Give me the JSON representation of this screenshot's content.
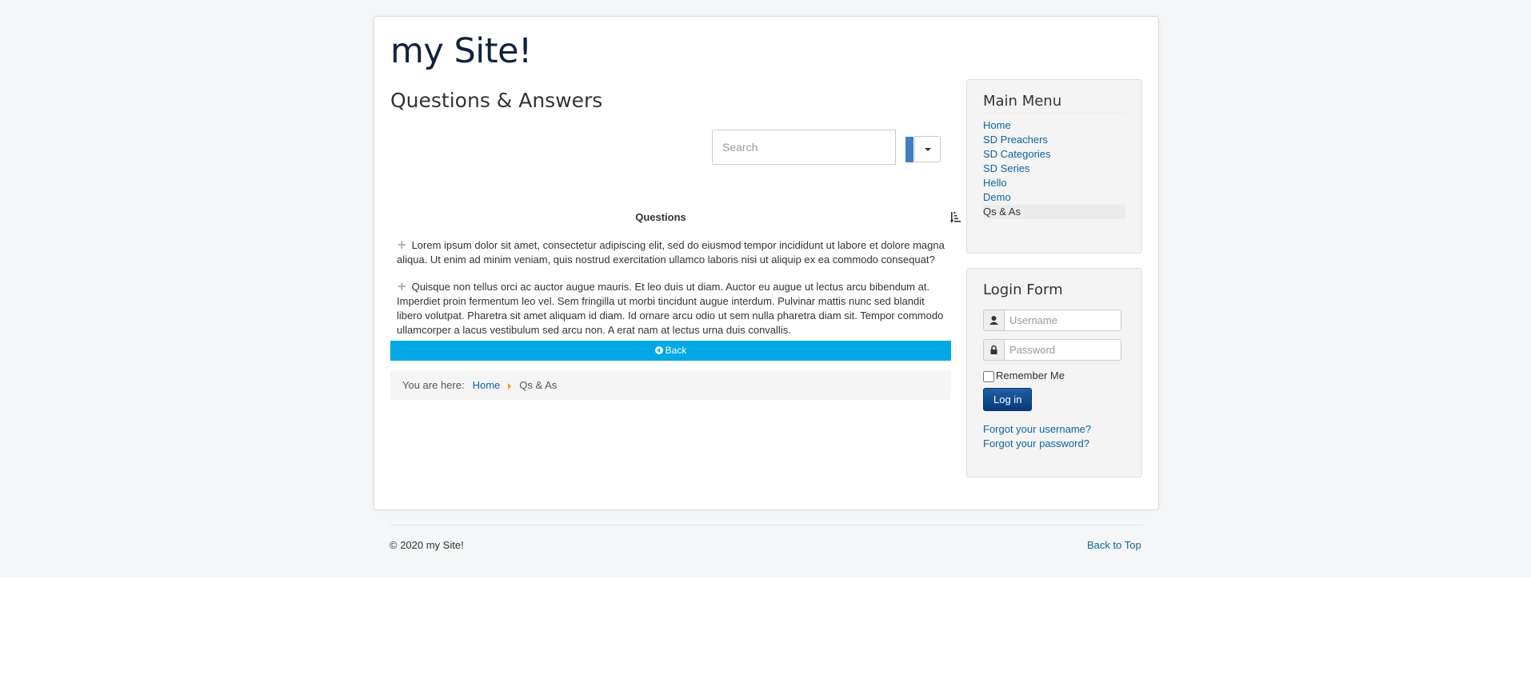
{
  "site": {
    "brand": "my Site!"
  },
  "page": {
    "title": "Questions & Answers"
  },
  "search": {
    "placeholder": "Search"
  },
  "questions": {
    "header": "Questions",
    "items": [
      "Lorem ipsum dolor sit amet, consectetur adipiscing elit, sed do eiusmod tempor incididunt ut labore et dolore magna aliqua. Ut enim ad minim veniam, quis nostrud exercitation ullamco laboris nisi ut aliquip ex ea commodo consequat?",
      "Quisque non tellus orci ac auctor augue mauris. Et leo duis ut diam. Auctor eu augue ut lectus arcu bibendum at. Imperdiet proin fermentum leo vel. Sem fringilla ut morbi tincidunt augue interdum. Pulvinar mattis nunc sed blandit libero volutpat. Pharetra sit amet aliquam id diam. Id ornare arcu odio ut sem nulla pharetra diam sit. Tempor commodo ullamcorper a lacus vestibulum sed arcu non. A erat nam at lectus urna duis convallis."
    ]
  },
  "back_button": {
    "label": "Back"
  },
  "breadcrumb": {
    "prefix": "You are here:",
    "home": "Home",
    "current": "Qs & As"
  },
  "main_menu": {
    "title": "Main Menu",
    "items": [
      "Home",
      "SD Preachers",
      "SD Categories",
      "SD Series",
      "Hello",
      "Demo",
      "Qs & As"
    ],
    "active_index": 6
  },
  "login": {
    "title": "Login Form",
    "username_placeholder": "Username",
    "password_placeholder": "Password",
    "remember_label": "Remember Me",
    "button_label": "Log in",
    "forgot_username": "Forgot your username?",
    "forgot_password": "Forgot your password?"
  },
  "footer": {
    "copyright": "© 2020 my Site!",
    "back_to_top": "Back to Top"
  },
  "colors": {
    "accent": "#00a8e6",
    "link": "#10649e",
    "brand": "#10223e",
    "breadcrumb_arrow": "#f2951c"
  }
}
